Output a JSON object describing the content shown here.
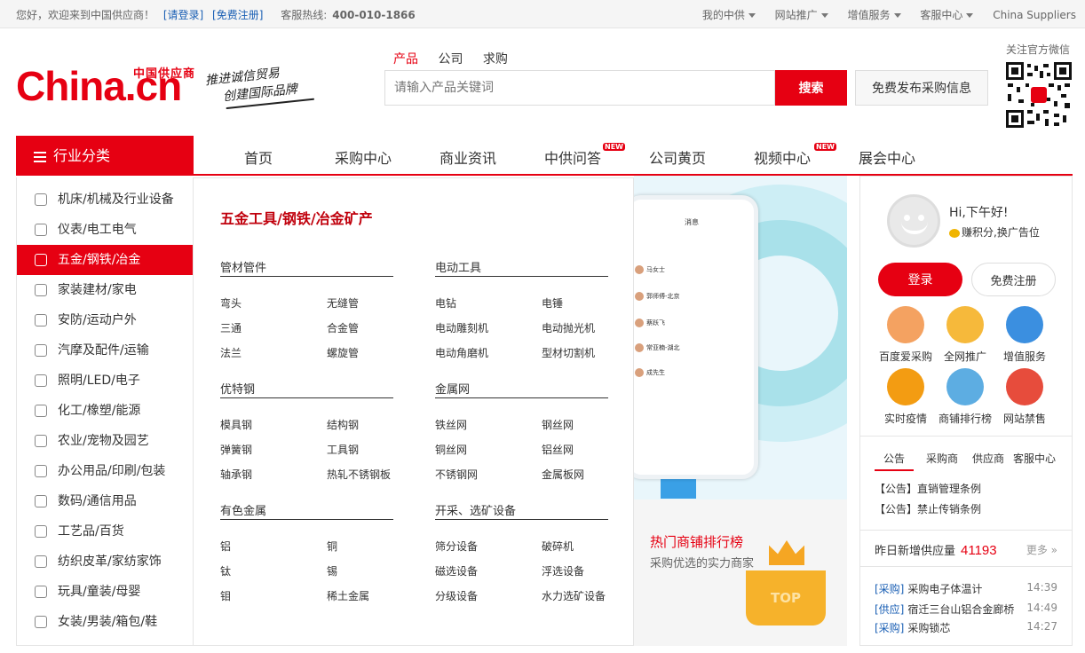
{
  "topbar": {
    "welcome": "您好，欢迎来到中国供应商！",
    "login": "[请登录]",
    "register": "[免费注册]",
    "hotline_label": "客服热线:",
    "hotline": "400-010-1866",
    "menus": [
      "我的中供",
      "网站推广",
      "增值服务",
      "客服中心"
    ],
    "china_suppliers": "China Suppliers"
  },
  "logo": {
    "text": "China.cn",
    "sub": "中国供应商",
    "slogan1": "推进诚信贸易",
    "slogan2": "创建国际品牌"
  },
  "search": {
    "tabs": [
      "产品",
      "公司",
      "求购"
    ],
    "active_tab": "产品",
    "placeholder": "请输入产品关键词",
    "button": "搜索",
    "publish_button": "免费发布采购信息"
  },
  "wechat": {
    "label": "关注官方微信"
  },
  "nav": {
    "category_header": "行业分类",
    "items": [
      "首页",
      "采购中心",
      "商业资讯",
      "中供问答",
      "公司黄页",
      "视频中心",
      "展会中心"
    ],
    "new_badge": "NEW"
  },
  "categories": [
    "机床/机械及行业设备",
    "仪表/电工电气",
    "五金/钢铁/冶金",
    "家装建材/家电",
    "安防/运动户外",
    "汽摩及配件/运输",
    "照明/LED/电子",
    "化工/橡塑/能源",
    "农业/宠物及园艺",
    "办公用品/印刷/包装",
    "数码/通信用品",
    "工艺品/百货",
    "纺织皮革/家纺家饰",
    "玩具/童装/母婴",
    "女装/男装/箱包/鞋"
  ],
  "active_category": "五金/钢铁/冶金",
  "mega": {
    "heading": "五金工具/钢铁/冶金矿产",
    "groups": [
      {
        "title": "管材管件",
        "items": [
          "弯头",
          "无缝管",
          "三通",
          "合金管",
          "法兰",
          "螺旋管"
        ]
      },
      {
        "title": "电动工具",
        "items": [
          "电钻",
          "电锤",
          "电动雕刻机",
          "电动抛光机",
          "电动角磨机",
          "型材切割机"
        ]
      },
      {
        "title": "优特钢",
        "items": [
          "模具钢",
          "结构钢",
          "弹簧钢",
          "工具钢",
          "轴承钢",
          "热轧不锈钢板"
        ]
      },
      {
        "title": "金属网",
        "items": [
          "铁丝网",
          "钢丝网",
          "铜丝网",
          "铝丝网",
          "不锈钢网",
          "金属板网"
        ]
      },
      {
        "title": "有色金属",
        "items": [
          "铝",
          "铜",
          "钛",
          "锡",
          "钼",
          "稀土金属"
        ]
      },
      {
        "title": "开采、选矿设备",
        "items": [
          "筛分设备",
          "破碎机",
          "磁选设备",
          "浮选设备",
          "分级设备",
          "水力选矿设备"
        ]
      }
    ]
  },
  "banner": {
    "phone_title": "消息",
    "messages": [
      "马女士",
      "郭师傅-北京",
      "蔡跃飞",
      "常亚楠-湖北",
      "成先生"
    ]
  },
  "hot_shop": {
    "title": "热门商铺排行榜",
    "subtitle": "采购优选的实力商家",
    "badge": "TOP"
  },
  "user": {
    "greeting": "Hi,下午好!",
    "points": "赚积分,换广告位",
    "login_button": "登录",
    "register_button": "免费注册"
  },
  "services": [
    "百度爱采购",
    "全网推广",
    "增值服务",
    "实时疫情",
    "商铺排行榜",
    "网站禁售"
  ],
  "service_colors": [
    "#f4a261",
    "#f6b93b",
    "#3b8fe0",
    "#f39c12",
    "#5dade2",
    "#e74c3c"
  ],
  "notice": {
    "tabs": [
      "公告",
      "采购商",
      "供应商",
      "客服中心"
    ],
    "items": [
      "【公告】直销管理条例",
      "【公告】禁止传销条例"
    ]
  },
  "today": {
    "label": "昨日新增供应量",
    "count": "41193",
    "more": "更多 »"
  },
  "news": [
    {
      "tag": "[采购]",
      "text": "采购电子体温计",
      "time": "14:39"
    },
    {
      "tag": "[供应]",
      "text": "宿迁三台山铝合金廊桥",
      "time": "14:49"
    },
    {
      "tag": "[采购]",
      "text": "采购锁芯",
      "time": "14:27"
    }
  ],
  "colors": {
    "brand": "#e60012",
    "link": "#1a5fb4"
  }
}
